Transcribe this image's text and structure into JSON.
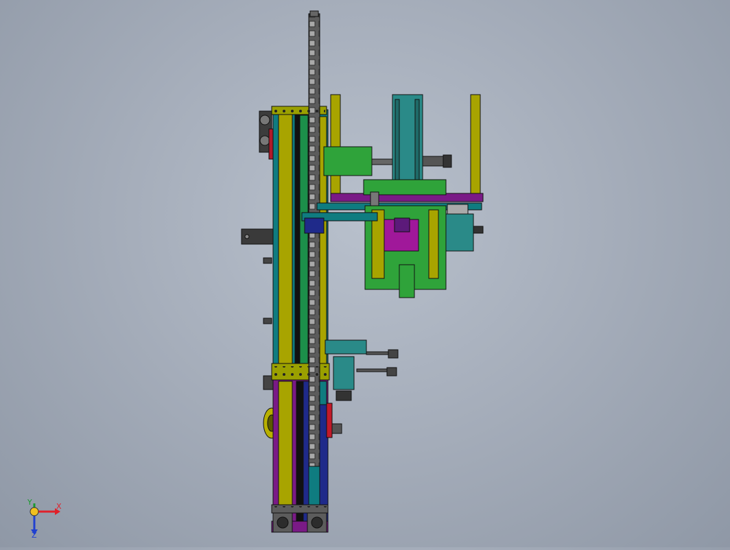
{
  "window": {
    "type": "cad-viewport",
    "view": "orthographic"
  },
  "colors": {
    "background": "#a6aebb",
    "rail_teal": "#0f7c80",
    "olive": "#a8a400",
    "purple": "#7a1a86",
    "navy": "#1f2a8a",
    "green": "#35a83a",
    "magenta": "#a0189a",
    "motor_teal": "#2a8a88",
    "dark": "#2e2e2e",
    "red": "#c21a2a"
  },
  "triad": {
    "x_label": "X",
    "y_label": "Y",
    "z_label": "Z",
    "x_color": "#e0202a",
    "y_color": "#1a9a30",
    "z_color": "#2040d0"
  }
}
